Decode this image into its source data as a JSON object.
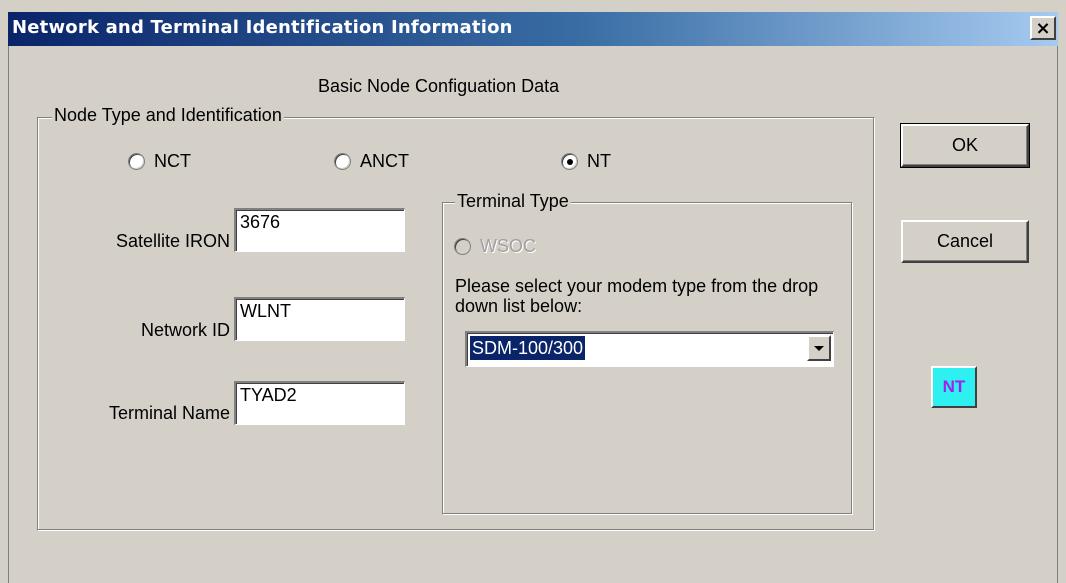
{
  "window": {
    "title": "Network and Terminal Identification Information",
    "close_glyph": "×"
  },
  "heading": "Basic Node Configuation Data",
  "node_group": {
    "title": "Node Type and Identification",
    "radios": [
      {
        "label": "NCT",
        "checked": false
      },
      {
        "label": "ANCT",
        "checked": false
      },
      {
        "label": "NT",
        "checked": true
      }
    ]
  },
  "fields": {
    "satellite_iron": {
      "label": "Satellite IRON",
      "value": "3676"
    },
    "network_id": {
      "label": "Network ID",
      "value": "WLNT"
    },
    "terminal_name": {
      "label": "Terminal Name",
      "value": "TYAD2"
    }
  },
  "terminal_group": {
    "title": "Terminal Type",
    "wsoc_label": "WSOC",
    "wsoc_enabled": false,
    "hint": "Please select your modem type from the drop down list below:",
    "modem_selected": "SDM-100/300"
  },
  "buttons": {
    "ok": "OK",
    "cancel": "Cancel"
  },
  "badge": {
    "text": "NT",
    "background": "#2ef0f0",
    "color": "#a020f0"
  },
  "colors": {
    "dialog_bg": "#d4d0c8",
    "title_gradient_start": "#0a246a",
    "title_gradient_end": "#a6caf0",
    "selection": "#0a246a"
  }
}
